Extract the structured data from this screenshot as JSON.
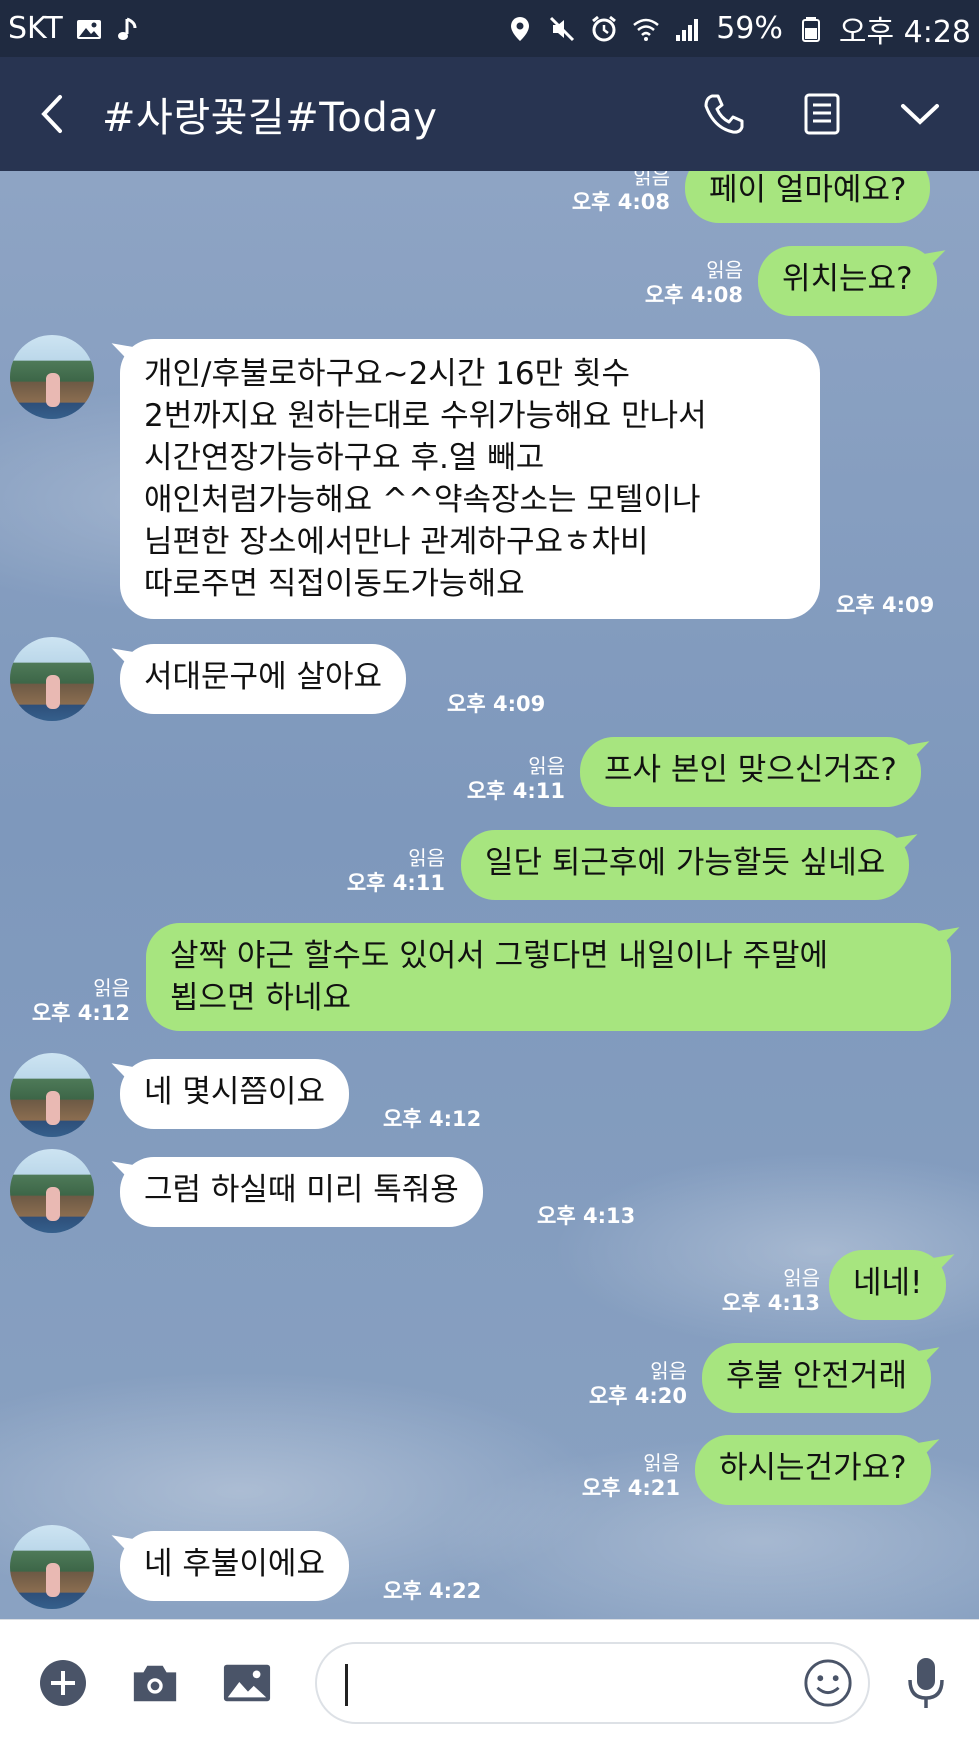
{
  "status_bar": {
    "carrier": "SKT",
    "battery": "59%",
    "time": "오후 4:28",
    "icons": [
      "image-icon",
      "music-note-icon",
      "location-icon",
      "mute-icon",
      "alarm-icon",
      "wifi-icon",
      "signal-icon",
      "battery-icon"
    ]
  },
  "header": {
    "title": "#사랑꽃길#Today",
    "icons": [
      "back-arrow-icon",
      "phone-icon",
      "notes-icon",
      "chevron-down-icon"
    ]
  },
  "messages": [
    {
      "from": "me",
      "text": "페이 얼마예요?",
      "read": "읽음",
      "time": "오후 4:08"
    },
    {
      "from": "me",
      "text": "위치는요?",
      "read": "읽음",
      "time": "오후 4:08"
    },
    {
      "from": "them",
      "text": "개인/후불로하구요~2시간 16만 횟수\n2번까지요 원하는대로 수위가능해요 만나서\n시간연장가능하구요 후.얼 빼고\n애인처럼가능해요 ^^약속장소는 모텔이나\n님편한 장소에서만나 관계하구요ㅎ차비\n따로주면 직접이동도가능해요",
      "time": "오후 4:09"
    },
    {
      "from": "them",
      "text": "서대문구에 살아요",
      "time": "오후 4:09"
    },
    {
      "from": "me",
      "text": "프사 본인 맞으신거죠?",
      "read": "읽음",
      "time": "오후 4:11"
    },
    {
      "from": "me",
      "text": "일단 퇴근후에 가능할듯 싶네요",
      "read": "읽음",
      "time": "오후 4:11"
    },
    {
      "from": "me",
      "text": "살짝 야근 할수도 있어서 그렇다면 내일이나 주말에\n뵙으면 하네요",
      "read": "읽음",
      "time": "오후 4:12"
    },
    {
      "from": "them",
      "text": "네 몇시쯤이요",
      "time": "오후 4:12"
    },
    {
      "from": "them",
      "text": "그럼 하실때 미리 톡줘용",
      "time": "오후 4:13"
    },
    {
      "from": "me",
      "text": "네네!",
      "read": "읽음",
      "time": "오후 4:13"
    },
    {
      "from": "me",
      "text": "후불 안전거래",
      "read": "읽음",
      "time": "오후 4:20"
    },
    {
      "from": "me",
      "text": "하시는건가요?",
      "read": "읽음",
      "time": "오후 4:21"
    },
    {
      "from": "them",
      "text": "네 후불이에요",
      "time": "오후 4:22"
    }
  ],
  "input_bar": {
    "value": "",
    "icons": [
      "plus-icon",
      "camera-icon",
      "image-icon",
      "emoji-icon",
      "microphone-icon"
    ]
  },
  "colors": {
    "status_bar_bg": "#1f2a40",
    "header_bg": "#283451",
    "chat_bg": "#7f98bb",
    "my_bubble": "#a7e57f",
    "their_bubble": "#ffffff"
  }
}
